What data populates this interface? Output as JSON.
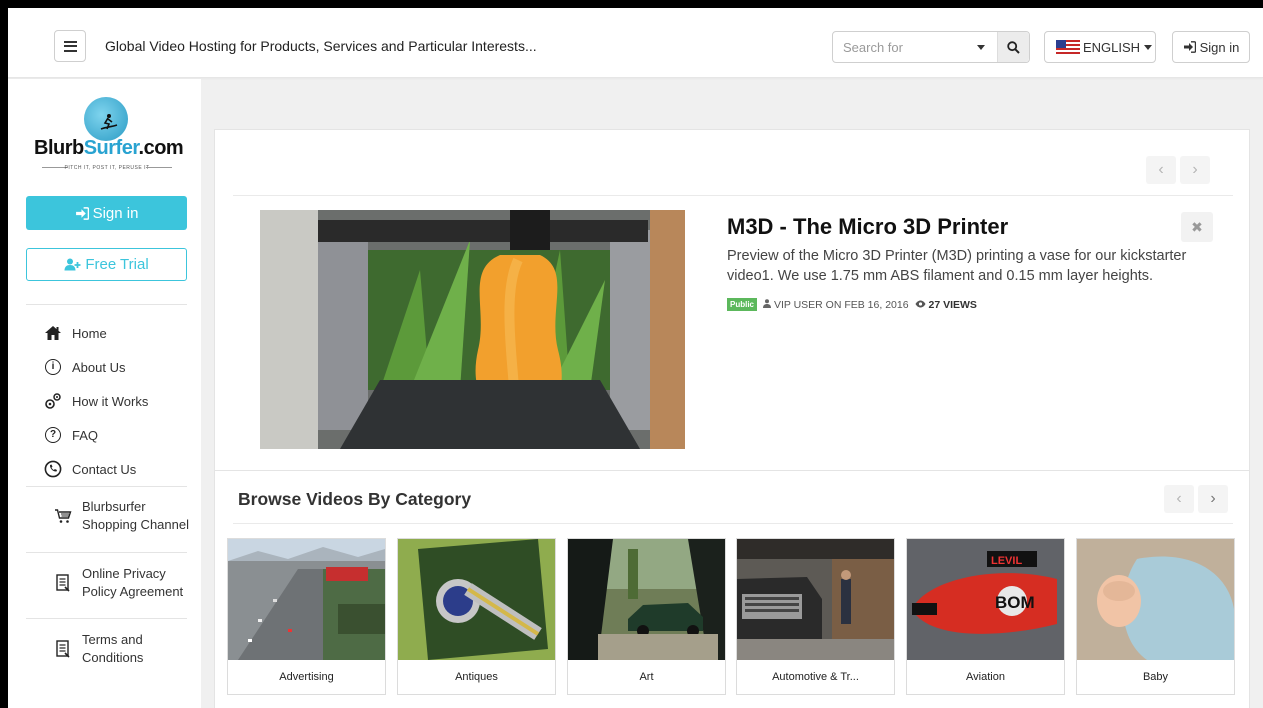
{
  "header": {
    "tagline": "Global Video Hosting for Products, Services and Particular Interests...",
    "search_placeholder": "Search for",
    "language": "ENGLISH",
    "signin_label": "Sign in"
  },
  "sidebar": {
    "logo": {
      "word_start": "Blurb",
      "word_accent": "Surfer",
      "word_end": ".com",
      "slogan": "PITCH IT, POST IT, PERUSE IT"
    },
    "signin_label": "Sign in",
    "trial_label": "Free Trial",
    "nav": [
      {
        "label": "Home",
        "icon": "home-icon"
      },
      {
        "label": "About Us",
        "icon": "info-icon"
      },
      {
        "label": "How it Works",
        "icon": "gears-icon"
      },
      {
        "label": "FAQ",
        "icon": "question-icon"
      },
      {
        "label": "Contact Us",
        "icon": "phone-icon"
      }
    ],
    "extras": [
      {
        "label": "Blurbsurfer Shopping Channel",
        "icon": "cart-icon"
      },
      {
        "label": "Online Privacy Policy Agreement",
        "icon": "document-icon"
      },
      {
        "label": "Terms and Conditions",
        "icon": "document-icon"
      }
    ]
  },
  "featured": {
    "title": "M3D - The Micro 3D Printer",
    "description": "Preview of the Micro 3D Printer (M3D) printing a vase for our kickstarter video1. We use 1.75 mm ABS filament and 0.15 mm layer heights.",
    "badge": "Public",
    "author_date": "VIP USER ON FEB 16, 2016",
    "views": "27 VIEWS"
  },
  "browse": {
    "title": "Browse Videos By Category",
    "categories": [
      "Advertising",
      "Antiques",
      "Art",
      "Automotive & Tr...",
      "Aviation",
      "Baby"
    ]
  },
  "colors": {
    "accent": "#3cc5dc",
    "public_badge": "#5cb85c",
    "brand_blue": "#29a3d1"
  }
}
